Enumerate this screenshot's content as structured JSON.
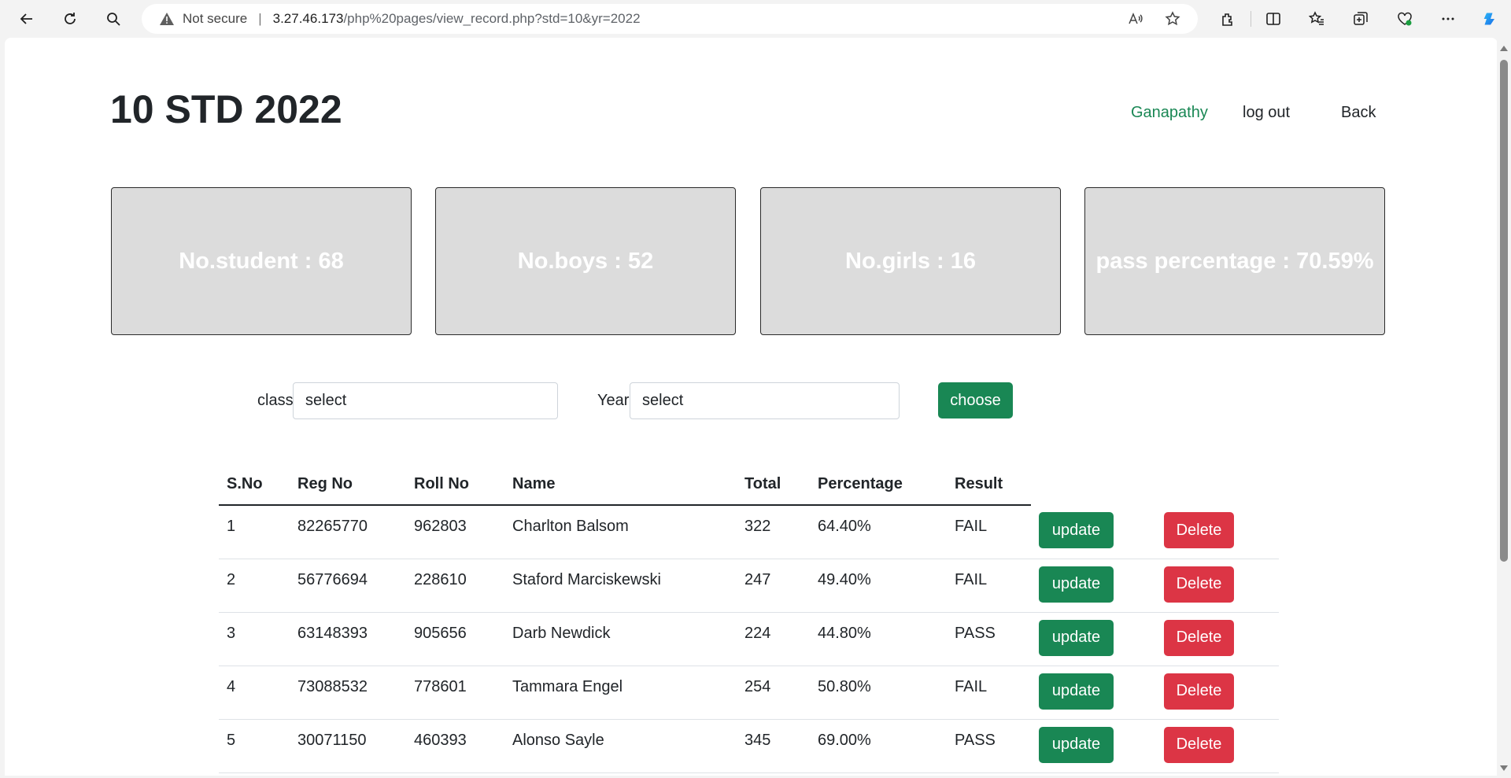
{
  "browser": {
    "security_label": "Not secure",
    "url_host": "3.27.46.173",
    "url_path": "/php%20pages/view_record.php?std=10&yr=2022"
  },
  "header": {
    "title": "10 STD 2022",
    "user": "Ganapathy",
    "logout": "log out",
    "back": "Back"
  },
  "stats": [
    {
      "label": "No.student : 68"
    },
    {
      "label": "No.boys : 52"
    },
    {
      "label": "No.girls : 16"
    },
    {
      "label": "pass percentage : 70.59%"
    }
  ],
  "filters": {
    "class_label": "class:",
    "class_value": "select",
    "year_label": "Year:",
    "year_value": "select",
    "choose_label": "choose"
  },
  "table": {
    "headers": [
      "S.No",
      "Reg No",
      "Roll No",
      "Name",
      "Total",
      "Percentage",
      "Result"
    ],
    "update_label": "update",
    "delete_label": "Delete",
    "rows": [
      {
        "sno": "1",
        "reg": "82265770",
        "roll": "962803",
        "name": "Charlton Balsom",
        "total": "322",
        "pct": "64.40%",
        "result": "FAIL"
      },
      {
        "sno": "2",
        "reg": "56776694",
        "roll": "228610",
        "name": "Staford Marciskewski",
        "total": "247",
        "pct": "49.40%",
        "result": "FAIL"
      },
      {
        "sno": "3",
        "reg": "63148393",
        "roll": "905656",
        "name": "Darb Newdick",
        "total": "224",
        "pct": "44.80%",
        "result": "PASS"
      },
      {
        "sno": "4",
        "reg": "73088532",
        "roll": "778601",
        "name": "Tammara Engel",
        "total": "254",
        "pct": "50.80%",
        "result": "FAIL"
      },
      {
        "sno": "5",
        "reg": "30071150",
        "roll": "460393",
        "name": "Alonso Sayle",
        "total": "345",
        "pct": "69.00%",
        "result": "PASS"
      }
    ]
  }
}
